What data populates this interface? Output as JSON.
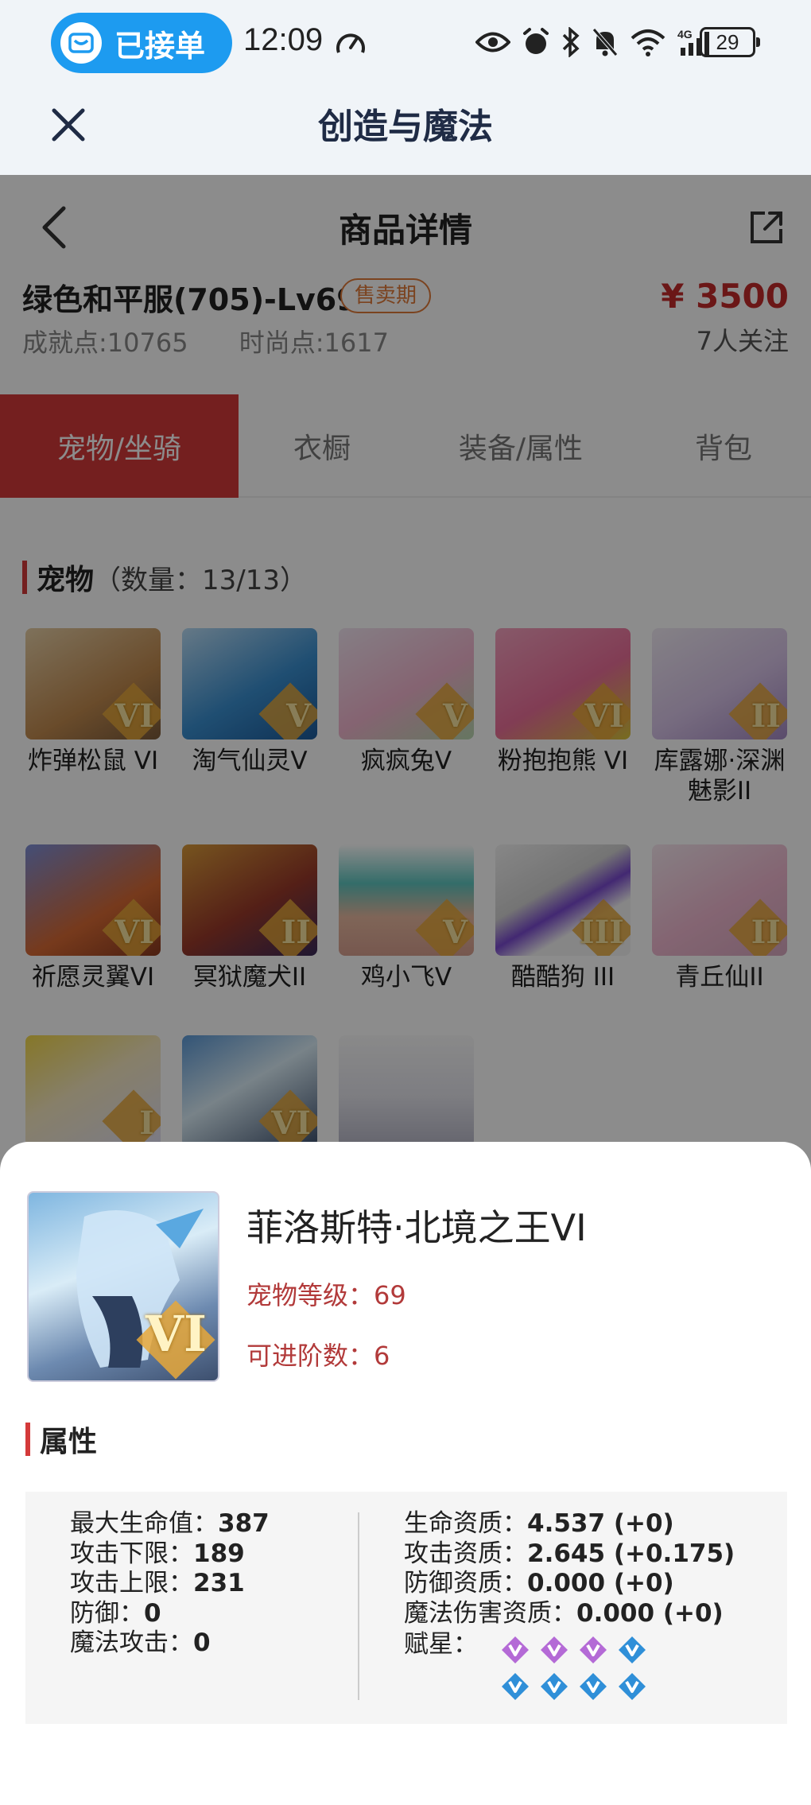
{
  "status_bar": {
    "order_pill": "已接单",
    "time": "12:09",
    "battery": "29"
  },
  "app_bar": {
    "title": "创造与魔法"
  },
  "page": {
    "title": "商品详情",
    "product_name": "绿色和平服(705)-Lv69",
    "badge": "售卖期",
    "price": "¥ 3500",
    "achievement": "成就点:10765",
    "fashion": "时尚点:1617",
    "followers": "7人关注"
  },
  "tabs": [
    {
      "label": "宠物/坐骑",
      "active": true
    },
    {
      "label": "衣橱",
      "active": false
    },
    {
      "label": "装备/属性",
      "active": false
    },
    {
      "label": "背包",
      "active": false
    }
  ],
  "pet_section": {
    "label": "宠物",
    "count": "（数量：13/13）"
  },
  "pets": [
    {
      "name": "炸弹松鼠 VI",
      "rank": "VI"
    },
    {
      "name": "淘气仙灵V",
      "rank": "V"
    },
    {
      "name": "疯疯兔V",
      "rank": "V"
    },
    {
      "name": "粉抱抱熊 VI",
      "rank": "VI"
    },
    {
      "name": "库露娜·深渊魅影II",
      "rank": "II"
    },
    {
      "name": "祈愿灵翼VI",
      "rank": "VI"
    },
    {
      "name": "冥狱魔犬II",
      "rank": "II"
    },
    {
      "name": "鸡小飞V",
      "rank": "V"
    },
    {
      "name": "酷酷狗 III",
      "rank": "III"
    },
    {
      "name": "青丘仙II",
      "rank": "II"
    },
    {
      "name": "",
      "rank": "I"
    },
    {
      "name": "",
      "rank": "VI"
    },
    {
      "name": "",
      "rank": ""
    }
  ],
  "detail": {
    "name": "菲洛斯特·北境之王VI",
    "rank_overlay": "VI",
    "level_label": "宠物等级：",
    "level_value": "69",
    "advance_label": "可进阶数：",
    "advance_value": "6",
    "section_label": "属性",
    "left_stats": [
      {
        "label": "最大生命值：",
        "value": "387"
      },
      {
        "label": "攻击下限：",
        "value": "189"
      },
      {
        "label": "攻击上限：",
        "value": "231"
      },
      {
        "label": "防御：",
        "value": "0"
      },
      {
        "label": "魔法攻击：",
        "value": "0"
      }
    ],
    "right_stats": [
      {
        "label": "生命资质：",
        "value": "4.537 (+0)"
      },
      {
        "label": "攻击资质：",
        "value": "2.645 (+0.175)"
      },
      {
        "label": "防御资质：",
        "value": "0.000 (+0)"
      },
      {
        "label": "魔法伤害资质：",
        "value": "0.000 (+0)"
      }
    ],
    "stars_label": "赋星：",
    "stars": [
      "purple",
      "purple",
      "purple",
      "blue",
      "blue",
      "blue",
      "blue",
      "blue"
    ]
  },
  "colors": {
    "accent_red": "#d43a3a",
    "price_red": "#c42a2a",
    "pill_blue": "#1d9bf0",
    "star_purple": "#b46ad6",
    "star_blue": "#2f8fd8"
  }
}
